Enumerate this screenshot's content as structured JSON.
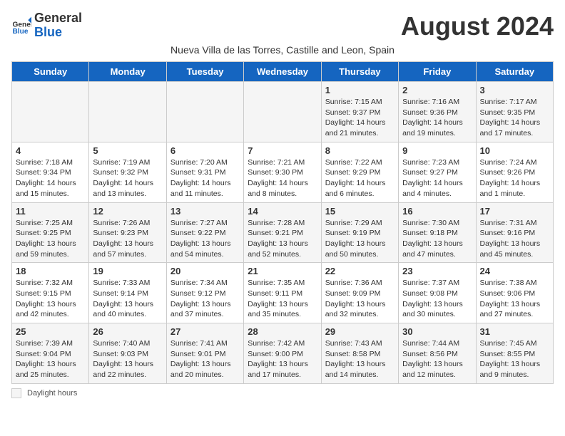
{
  "header": {
    "logo_general": "General",
    "logo_blue": "Blue",
    "month_title": "August 2024",
    "subtitle": "Nueva Villa de las Torres, Castille and Leon, Spain"
  },
  "columns": [
    "Sunday",
    "Monday",
    "Tuesday",
    "Wednesday",
    "Thursday",
    "Friday",
    "Saturday"
  ],
  "weeks": [
    [
      {
        "day": "",
        "info": ""
      },
      {
        "day": "",
        "info": ""
      },
      {
        "day": "",
        "info": ""
      },
      {
        "day": "",
        "info": ""
      },
      {
        "day": "1",
        "info": "Sunrise: 7:15 AM\nSunset: 9:37 PM\nDaylight: 14 hours\nand 21 minutes."
      },
      {
        "day": "2",
        "info": "Sunrise: 7:16 AM\nSunset: 9:36 PM\nDaylight: 14 hours\nand 19 minutes."
      },
      {
        "day": "3",
        "info": "Sunrise: 7:17 AM\nSunset: 9:35 PM\nDaylight: 14 hours\nand 17 minutes."
      }
    ],
    [
      {
        "day": "4",
        "info": "Sunrise: 7:18 AM\nSunset: 9:34 PM\nDaylight: 14 hours\nand 15 minutes."
      },
      {
        "day": "5",
        "info": "Sunrise: 7:19 AM\nSunset: 9:32 PM\nDaylight: 14 hours\nand 13 minutes."
      },
      {
        "day": "6",
        "info": "Sunrise: 7:20 AM\nSunset: 9:31 PM\nDaylight: 14 hours\nand 11 minutes."
      },
      {
        "day": "7",
        "info": "Sunrise: 7:21 AM\nSunset: 9:30 PM\nDaylight: 14 hours\nand 8 minutes."
      },
      {
        "day": "8",
        "info": "Sunrise: 7:22 AM\nSunset: 9:29 PM\nDaylight: 14 hours\nand 6 minutes."
      },
      {
        "day": "9",
        "info": "Sunrise: 7:23 AM\nSunset: 9:27 PM\nDaylight: 14 hours\nand 4 minutes."
      },
      {
        "day": "10",
        "info": "Sunrise: 7:24 AM\nSunset: 9:26 PM\nDaylight: 14 hours\nand 1 minute."
      }
    ],
    [
      {
        "day": "11",
        "info": "Sunrise: 7:25 AM\nSunset: 9:25 PM\nDaylight: 13 hours\nand 59 minutes."
      },
      {
        "day": "12",
        "info": "Sunrise: 7:26 AM\nSunset: 9:23 PM\nDaylight: 13 hours\nand 57 minutes."
      },
      {
        "day": "13",
        "info": "Sunrise: 7:27 AM\nSunset: 9:22 PM\nDaylight: 13 hours\nand 54 minutes."
      },
      {
        "day": "14",
        "info": "Sunrise: 7:28 AM\nSunset: 9:21 PM\nDaylight: 13 hours\nand 52 minutes."
      },
      {
        "day": "15",
        "info": "Sunrise: 7:29 AM\nSunset: 9:19 PM\nDaylight: 13 hours\nand 50 minutes."
      },
      {
        "day": "16",
        "info": "Sunrise: 7:30 AM\nSunset: 9:18 PM\nDaylight: 13 hours\nand 47 minutes."
      },
      {
        "day": "17",
        "info": "Sunrise: 7:31 AM\nSunset: 9:16 PM\nDaylight: 13 hours\nand 45 minutes."
      }
    ],
    [
      {
        "day": "18",
        "info": "Sunrise: 7:32 AM\nSunset: 9:15 PM\nDaylight: 13 hours\nand 42 minutes."
      },
      {
        "day": "19",
        "info": "Sunrise: 7:33 AM\nSunset: 9:14 PM\nDaylight: 13 hours\nand 40 minutes."
      },
      {
        "day": "20",
        "info": "Sunrise: 7:34 AM\nSunset: 9:12 PM\nDaylight: 13 hours\nand 37 minutes."
      },
      {
        "day": "21",
        "info": "Sunrise: 7:35 AM\nSunset: 9:11 PM\nDaylight: 13 hours\nand 35 minutes."
      },
      {
        "day": "22",
        "info": "Sunrise: 7:36 AM\nSunset: 9:09 PM\nDaylight: 13 hours\nand 32 minutes."
      },
      {
        "day": "23",
        "info": "Sunrise: 7:37 AM\nSunset: 9:08 PM\nDaylight: 13 hours\nand 30 minutes."
      },
      {
        "day": "24",
        "info": "Sunrise: 7:38 AM\nSunset: 9:06 PM\nDaylight: 13 hours\nand 27 minutes."
      }
    ],
    [
      {
        "day": "25",
        "info": "Sunrise: 7:39 AM\nSunset: 9:04 PM\nDaylight: 13 hours\nand 25 minutes."
      },
      {
        "day": "26",
        "info": "Sunrise: 7:40 AM\nSunset: 9:03 PM\nDaylight: 13 hours\nand 22 minutes."
      },
      {
        "day": "27",
        "info": "Sunrise: 7:41 AM\nSunset: 9:01 PM\nDaylight: 13 hours\nand 20 minutes."
      },
      {
        "day": "28",
        "info": "Sunrise: 7:42 AM\nSunset: 9:00 PM\nDaylight: 13 hours\nand 17 minutes."
      },
      {
        "day": "29",
        "info": "Sunrise: 7:43 AM\nSunset: 8:58 PM\nDaylight: 13 hours\nand 14 minutes."
      },
      {
        "day": "30",
        "info": "Sunrise: 7:44 AM\nSunset: 8:56 PM\nDaylight: 13 hours\nand 12 minutes."
      },
      {
        "day": "31",
        "info": "Sunrise: 7:45 AM\nSunset: 8:55 PM\nDaylight: 13 hours\nand 9 minutes."
      }
    ]
  ],
  "legend": {
    "label": "Daylight hours"
  }
}
